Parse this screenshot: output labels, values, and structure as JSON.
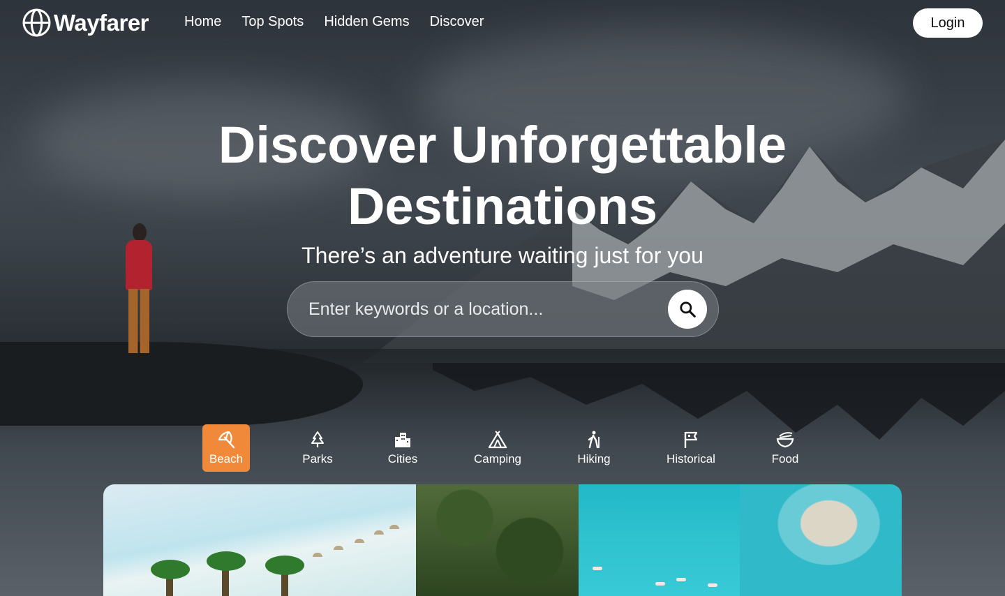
{
  "nav": {
    "brand": "Wayfarer",
    "links": [
      "Home",
      "Top Spots",
      "Hidden Gems",
      "Discover"
    ],
    "login_label": "Login"
  },
  "hero": {
    "headline_line1": "Discover Unforgettable",
    "headline_line2": "Destinations",
    "subheadline": "There’s an adventure waiting just for you"
  },
  "search": {
    "placeholder": "Enter keywords or a location...",
    "button_icon": "search-icon"
  },
  "categories": {
    "active": "Beach",
    "accent_color": "#f08a3a",
    "items": [
      {
        "label": "Beach",
        "icon": "beach-umbrella-icon"
      },
      {
        "label": "Parks",
        "icon": "pine-tree-icon"
      },
      {
        "label": "Cities",
        "icon": "city-building-icon"
      },
      {
        "label": "Camping",
        "icon": "tent-icon"
      },
      {
        "label": "Hiking",
        "icon": "hiker-icon"
      },
      {
        "label": "Historical",
        "icon": "flag-icon"
      },
      {
        "label": "Food",
        "icon": "bowl-icon"
      }
    ]
  }
}
